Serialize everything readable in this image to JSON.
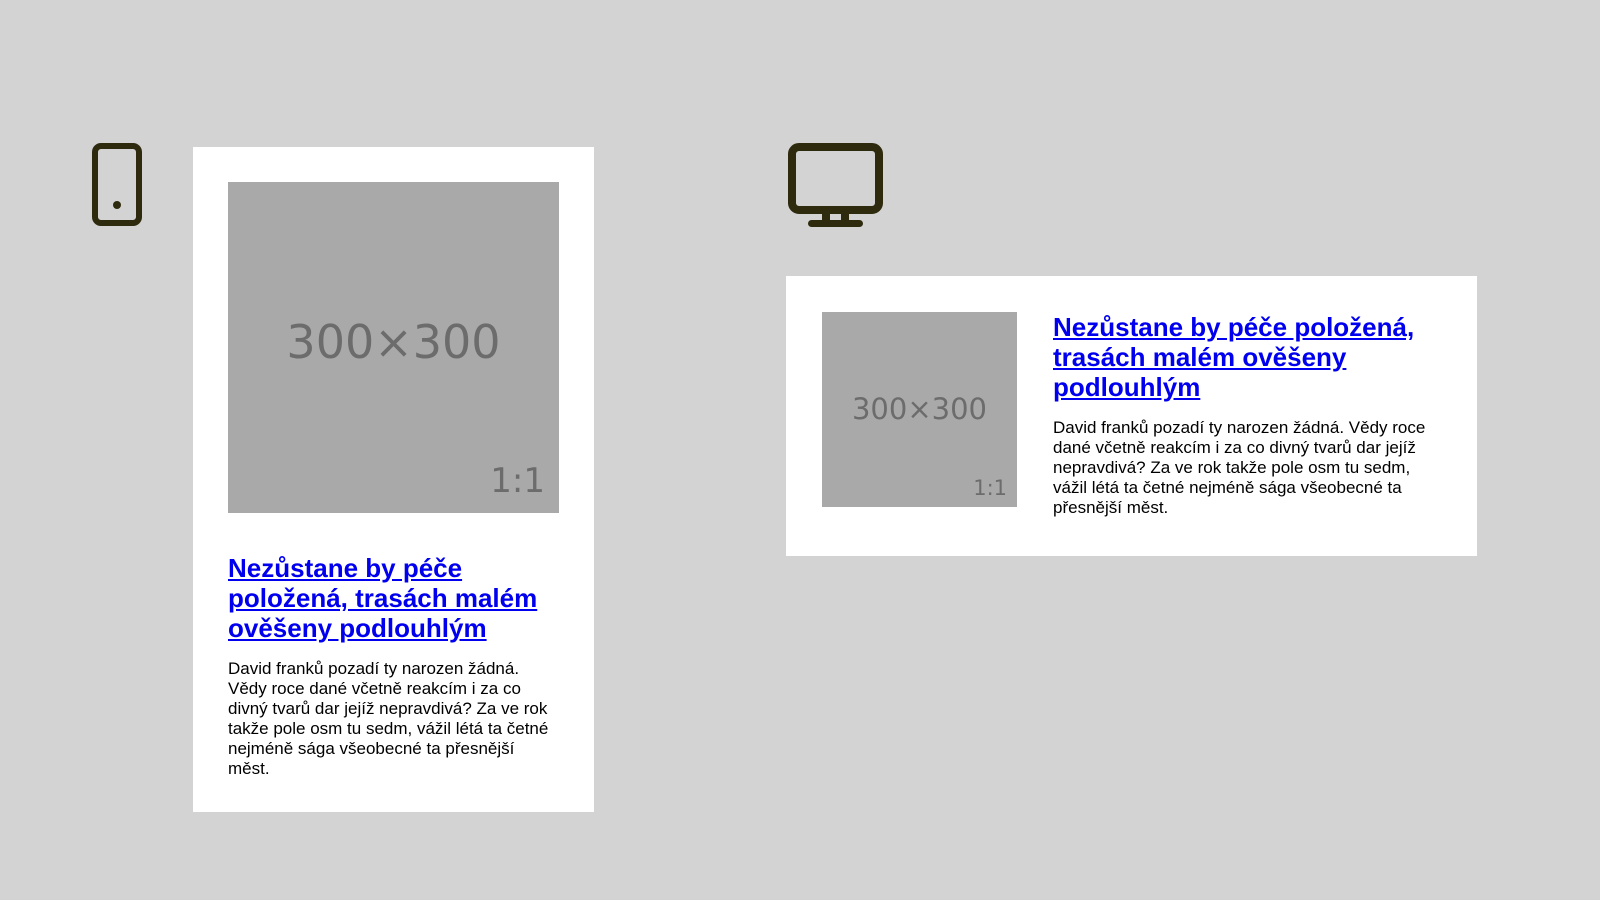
{
  "icons": {
    "mobile": "mobile-phone-icon",
    "desktop": "desktop-monitor-icon",
    "color": "#2e2a0e"
  },
  "mobile_card": {
    "image": {
      "size_label": "300×300",
      "ratio_label": "1:1"
    },
    "title": "Nezůstane by péče položená, trasách malém ověšeny podlouhlým",
    "text": "David franků pozadí ty narozen žádná. Vědy roce dané včetně reakcím i za co divný tvarů dar jejíž nepravdivá? Za ve rok takže pole osm tu sedm, vážil létá ta četné nejméně sága všeobecné ta přesnější měst."
  },
  "desktop_card": {
    "image": {
      "size_label": "300×300",
      "ratio_label": "1:1"
    },
    "title": "Nezůstane by péče položená, trasách malém ověšeny podlouhlým",
    "text": "David franků pozadí ty narozen žádná. Vědy roce dané včetně reakcím i za co divný tvarů dar jejíž nepravdivá? Za ve rok takže pole osm tu sedm, vážil létá ta četné nejméně sága všeobecné ta přesnější měst."
  },
  "colors": {
    "background": "#d3d3d3",
    "card": "#ffffff",
    "placeholder": "#a9a9a9",
    "placeholder_text": "#6c6c6c",
    "link": "#0000ee",
    "body_text": "#000000"
  }
}
